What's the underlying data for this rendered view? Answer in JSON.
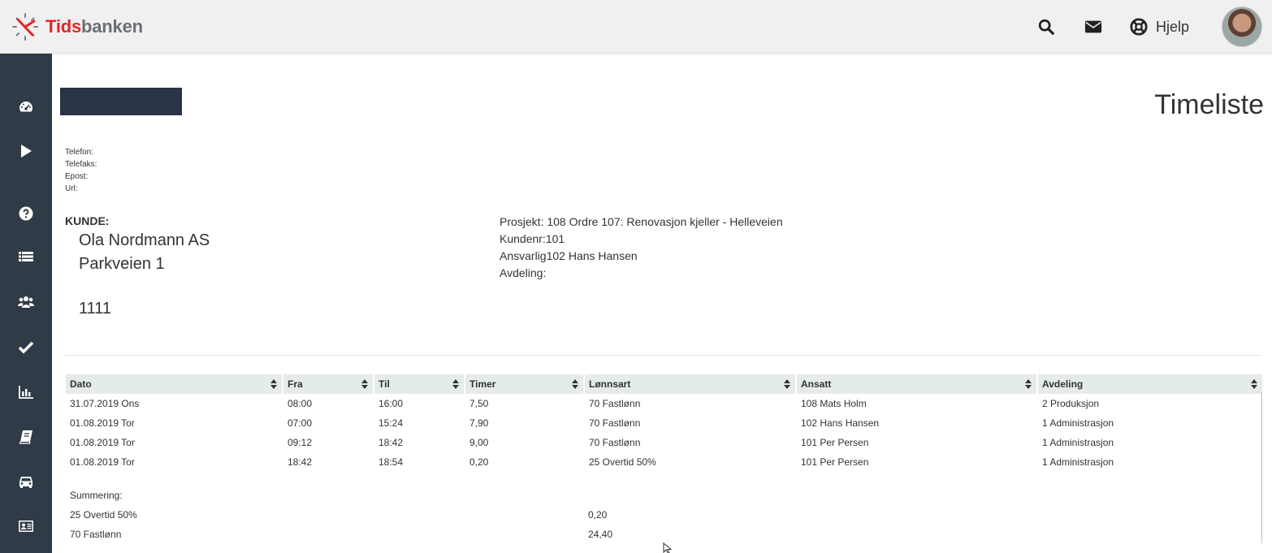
{
  "brand": {
    "part1": "Tids",
    "part2": "banken"
  },
  "header": {
    "help_label": "Hjelp"
  },
  "page_title": "Timeliste",
  "contact": {
    "telefon": "Telefon:",
    "telefaks": "Telefaks:",
    "epost": "Epost:",
    "url": "Url:"
  },
  "kunde": {
    "label": "KUNDE:",
    "name": "Ola Nordmann AS",
    "address": "Parkveien 1",
    "zip": "1111"
  },
  "project": {
    "prosjekt": "Prosjekt: 108 Ordre 107: Renovasjon kjeller - Helleveien",
    "kundenr": "Kundenr:101",
    "ansvarlig": "Ansvarlig102 Hans Hansen",
    "avdeling": "Avdeling:"
  },
  "table": {
    "headers": [
      "Dato",
      "Fra",
      "Til",
      "Timer",
      "Lønnsart",
      "Ansatt",
      "Avdeling"
    ],
    "rows": [
      [
        "31.07.2019 Ons",
        "08:00",
        "16:00",
        "7,50",
        "70 Fastlønn",
        "108 Mats Holm",
        "2 Produksjon"
      ],
      [
        "01.08.2019 Tor",
        "07:00",
        "15:24",
        "7,90",
        "70 Fastlønn",
        "102 Hans Hansen",
        "1 Administrasjon"
      ],
      [
        "01.08.2019 Tor",
        "09:12",
        "18:42",
        "9,00",
        "70 Fastlønn",
        "101 Per Persen",
        "1 Administrasjon"
      ],
      [
        "01.08.2019 Tor",
        "18:42",
        "18:54",
        "0,20",
        "25 Overtid 50%",
        "101 Per Persen",
        "1 Administrasjon"
      ]
    ]
  },
  "summary": {
    "label": "Summering:",
    "rows": [
      {
        "name": "25 Overtid 50%",
        "value": "0,20"
      },
      {
        "name": "70 Fastlønn",
        "value": "24,40"
      }
    ]
  },
  "icons": {
    "top": [
      "search-icon",
      "mail-icon",
      "lifebuoy-icon"
    ],
    "sidebar": [
      "dashboard-icon",
      "play-icon",
      "question-icon",
      "list-icon",
      "users-icon",
      "check-icon",
      "bar-chart-icon",
      "book-icon",
      "car-icon",
      "id-card-icon"
    ]
  },
  "colors": {
    "brand_red": "#e0262b",
    "sidebar": "#2f3b46",
    "table_header": "#e4ecea"
  }
}
